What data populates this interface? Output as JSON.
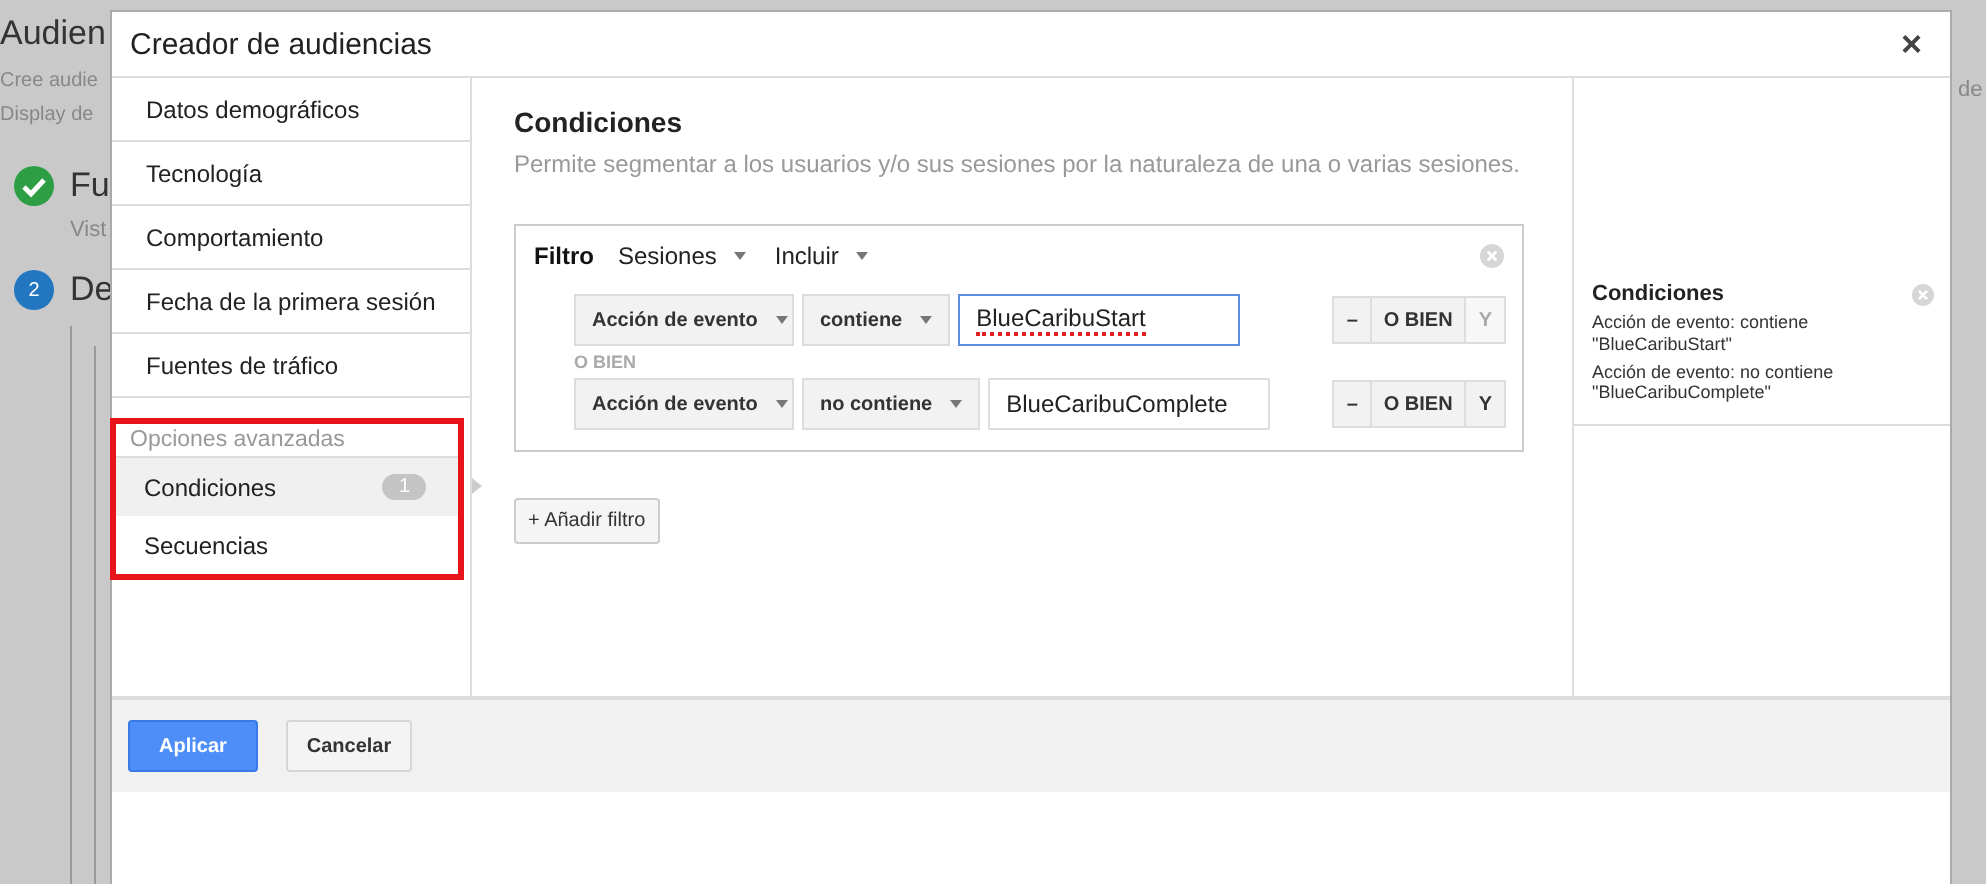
{
  "background_page": {
    "title": "Audien",
    "description": [
      "Cree audie",
      "Display de"
    ],
    "steps": [
      {
        "kind": "done",
        "title": "Fu",
        "subtitle": "Vist"
      },
      {
        "kind": "numbered",
        "number": "2",
        "title": "De"
      }
    ],
    "right_text": "de"
  },
  "dialog": {
    "title": "Creador de audiencias",
    "close": "×",
    "nav": {
      "items": [
        {
          "label": "Datos demográficos",
          "selected": false
        },
        {
          "label": "Tecnología",
          "selected": false
        },
        {
          "label": "Comportamiento",
          "selected": false
        },
        {
          "label": "Fecha de la primera sesión",
          "selected": false
        },
        {
          "label": "Fuentes de tráfico",
          "selected": false
        }
      ],
      "advanced": {
        "heading": "Opciones avanzadas",
        "highlighted": true,
        "items": [
          {
            "label": "Condiciones",
            "badge": "1",
            "selected": true
          },
          {
            "label": "Secuencias",
            "selected": false
          }
        ]
      }
    },
    "main": {
      "title": "Condiciones",
      "description": "Permite segmentar a los usuarios y/o sus sesiones por la naturaleza de una o varias sesiones.",
      "filter": {
        "label": "Filtro",
        "scope": "Sesiones",
        "mode": "Incluir",
        "rows": [
          {
            "dimension": "Acción de evento",
            "operator": "contiene",
            "value": "BlueCaribuStart",
            "focused": true,
            "spelling_error": true,
            "remove": "–",
            "or": "O BIEN",
            "and": "Y",
            "and_disabled": true
          },
          {
            "separator": "O BIEN",
            "dimension": "Acción de evento",
            "operator": "no contiene",
            "value": "BlueCaribuComplete",
            "focused": false,
            "spelling_error": false,
            "remove": "–",
            "or": "O BIEN",
            "and": "Y",
            "and_disabled": false
          }
        ]
      },
      "add_filter": "+ Añadir filtro"
    },
    "summary": {
      "title": "Condiciones",
      "lines": [
        "Acción de evento: contiene \"BlueCaribuStart\"",
        "Acción de evento: no contiene \"BlueCaribuComplete\""
      ]
    },
    "buttons": {
      "apply": "Aplicar",
      "cancel": "Cancelar"
    }
  }
}
